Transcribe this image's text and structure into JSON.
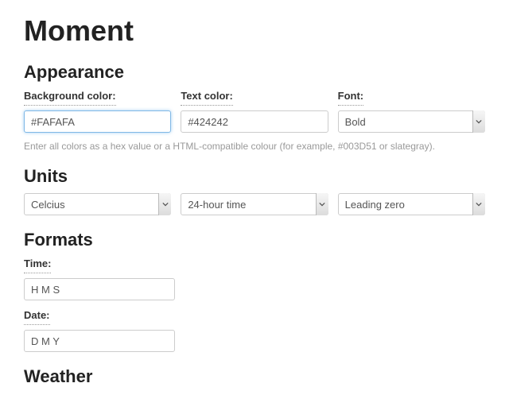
{
  "page": {
    "title": "Moment"
  },
  "appearance": {
    "heading": "Appearance",
    "bg_color": {
      "label": "Background color:",
      "value": "#FAFAFA"
    },
    "text_color": {
      "label": "Text color:",
      "value": "#424242"
    },
    "font": {
      "label": "Font:",
      "value": "Bold"
    },
    "hint": "Enter all colors as a hex value or a HTML-compatible colour (for example, #003D51 or slategray)."
  },
  "units": {
    "heading": "Units",
    "temperature": {
      "value": "Celcius"
    },
    "time": {
      "value": "24-hour time"
    },
    "zero": {
      "value": "Leading zero"
    }
  },
  "formats": {
    "heading": "Formats",
    "time": {
      "label": "Time:",
      "value": "H M S"
    },
    "date": {
      "label": "Date:",
      "value": "D M Y"
    }
  },
  "weather": {
    "heading": "Weather"
  }
}
